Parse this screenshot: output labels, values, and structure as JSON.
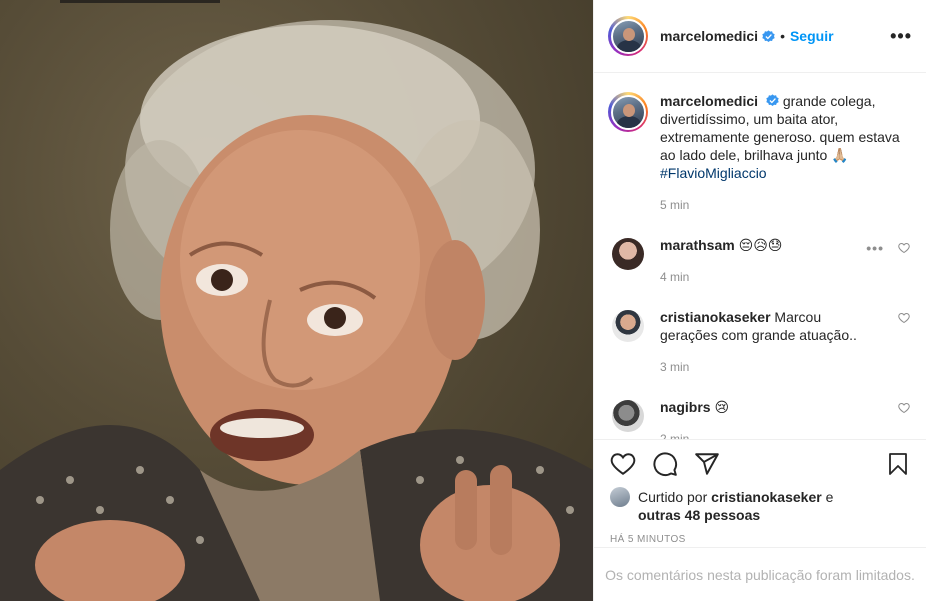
{
  "post": {
    "image_alt": "photo-portrait-elderly-man",
    "author": {
      "username": "marcelomedici",
      "verified": true,
      "follow_label": "Seguir",
      "separator": "•"
    },
    "more_options_icon": "more-horizontal-icon",
    "caption": {
      "username": "marcelomedici",
      "text": "grande colega, divertidíssimo, um baita ator, extremamente generoso. quem estava ao lado dele, brilhava junto 🙏🏼",
      "hashtag": "#FlavioMigliaccio",
      "time": "5 min"
    },
    "comments": [
      {
        "username": "marathsam",
        "text": "😔😥😓",
        "time": "4 min"
      },
      {
        "username": "cristianokaseker",
        "text": "Marcou gerações com grande atuação..",
        "time": "3 min"
      },
      {
        "username": "nagibrs",
        "text": "😢",
        "time": "2 min"
      }
    ],
    "actions": {
      "like_icon": "heart-icon",
      "comment_icon": "comment-icon",
      "share_icon": "share-icon",
      "save_icon": "bookmark-icon"
    },
    "likes": {
      "prefix": "Curtido por",
      "user": "cristianokaseker",
      "joiner": "e",
      "others": "outras 48 pessoas"
    },
    "timestamp": "HÁ 5 MINUTOS",
    "comments_limited": "Os comentários nesta publicação foram limitados."
  },
  "colors": {
    "link_blue": "#0095f6",
    "hashtag": "#00376b",
    "muted": "#8e8e8e"
  }
}
